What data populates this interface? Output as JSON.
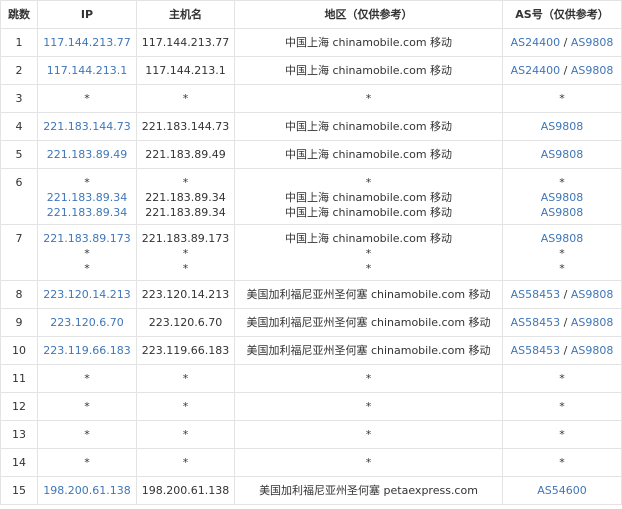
{
  "headers": {
    "hop": "跳数",
    "ip": "IP",
    "host": "主机名",
    "region": "地区（仅供参考）",
    "as": "AS号（仅供参考）"
  },
  "rows": [
    {
      "hop": "1",
      "lines": [
        {
          "ip": "117.144.213.77",
          "host": "117.144.213.77",
          "region": "中国上海 chinamobile.com 移动",
          "as": [
            "AS24400",
            "AS9808"
          ]
        }
      ]
    },
    {
      "hop": "2",
      "lines": [
        {
          "ip": "117.144.213.1",
          "host": "117.144.213.1",
          "region": "中国上海 chinamobile.com 移动",
          "as": [
            "AS24400",
            "AS9808"
          ]
        }
      ]
    },
    {
      "hop": "3",
      "lines": [
        {
          "ip": "*",
          "host": "*",
          "region": "*",
          "as": [
            "*"
          ]
        }
      ]
    },
    {
      "hop": "4",
      "lines": [
        {
          "ip": "221.183.144.73",
          "host": "221.183.144.73",
          "region": "中国上海 chinamobile.com 移动",
          "as": [
            "AS9808"
          ]
        }
      ]
    },
    {
      "hop": "5",
      "lines": [
        {
          "ip": "221.183.89.49",
          "host": "221.183.89.49",
          "region": "中国上海 chinamobile.com 移动",
          "as": [
            "AS9808"
          ]
        }
      ]
    },
    {
      "hop": "6",
      "lines": [
        {
          "ip": "*",
          "host": "*",
          "region": "*",
          "as": [
            "*"
          ]
        },
        {
          "ip": "221.183.89.34",
          "host": "221.183.89.34",
          "region": "中国上海 chinamobile.com 移动",
          "as": [
            "AS9808"
          ]
        },
        {
          "ip": "221.183.89.34",
          "host": "221.183.89.34",
          "region": "中国上海 chinamobile.com 移动",
          "as": [
            "AS9808"
          ]
        }
      ]
    },
    {
      "hop": "7",
      "lines": [
        {
          "ip": "221.183.89.173",
          "host": "221.183.89.173",
          "region": "中国上海 chinamobile.com 移动",
          "as": [
            "AS9808"
          ]
        },
        {
          "ip": "*",
          "host": "*",
          "region": "*",
          "as": [
            "*"
          ]
        },
        {
          "ip": "*",
          "host": "*",
          "region": "*",
          "as": [
            "*"
          ]
        }
      ]
    },
    {
      "hop": "8",
      "lines": [
        {
          "ip": "223.120.14.213",
          "host": "223.120.14.213",
          "region": "美国加利福尼亚州圣何塞 chinamobile.com 移动",
          "as": [
            "AS58453",
            "AS9808"
          ]
        }
      ]
    },
    {
      "hop": "9",
      "lines": [
        {
          "ip": "223.120.6.70",
          "host": "223.120.6.70",
          "region": "美国加利福尼亚州圣何塞 chinamobile.com 移动",
          "as": [
            "AS58453",
            "AS9808"
          ]
        }
      ]
    },
    {
      "hop": "10",
      "lines": [
        {
          "ip": "223.119.66.183",
          "host": "223.119.66.183",
          "region": "美国加利福尼亚州圣何塞 chinamobile.com 移动",
          "as": [
            "AS58453",
            "AS9808"
          ]
        }
      ]
    },
    {
      "hop": "11",
      "lines": [
        {
          "ip": "*",
          "host": "*",
          "region": "*",
          "as": [
            "*"
          ]
        }
      ]
    },
    {
      "hop": "12",
      "lines": [
        {
          "ip": "*",
          "host": "*",
          "region": "*",
          "as": [
            "*"
          ]
        }
      ]
    },
    {
      "hop": "13",
      "lines": [
        {
          "ip": "*",
          "host": "*",
          "region": "*",
          "as": [
            "*"
          ]
        }
      ]
    },
    {
      "hop": "14",
      "lines": [
        {
          "ip": "*",
          "host": "*",
          "region": "*",
          "as": [
            "*"
          ]
        }
      ]
    },
    {
      "hop": "15",
      "lines": [
        {
          "ip": "198.200.61.138",
          "host": "198.200.61.138",
          "region": "美国加利福尼亚州圣何塞 petaexpress.com",
          "as": [
            "AS54600"
          ]
        }
      ]
    }
  ],
  "colors": {
    "link": "#3f76b8",
    "text": "#333333",
    "border": "#e3e3e3"
  }
}
